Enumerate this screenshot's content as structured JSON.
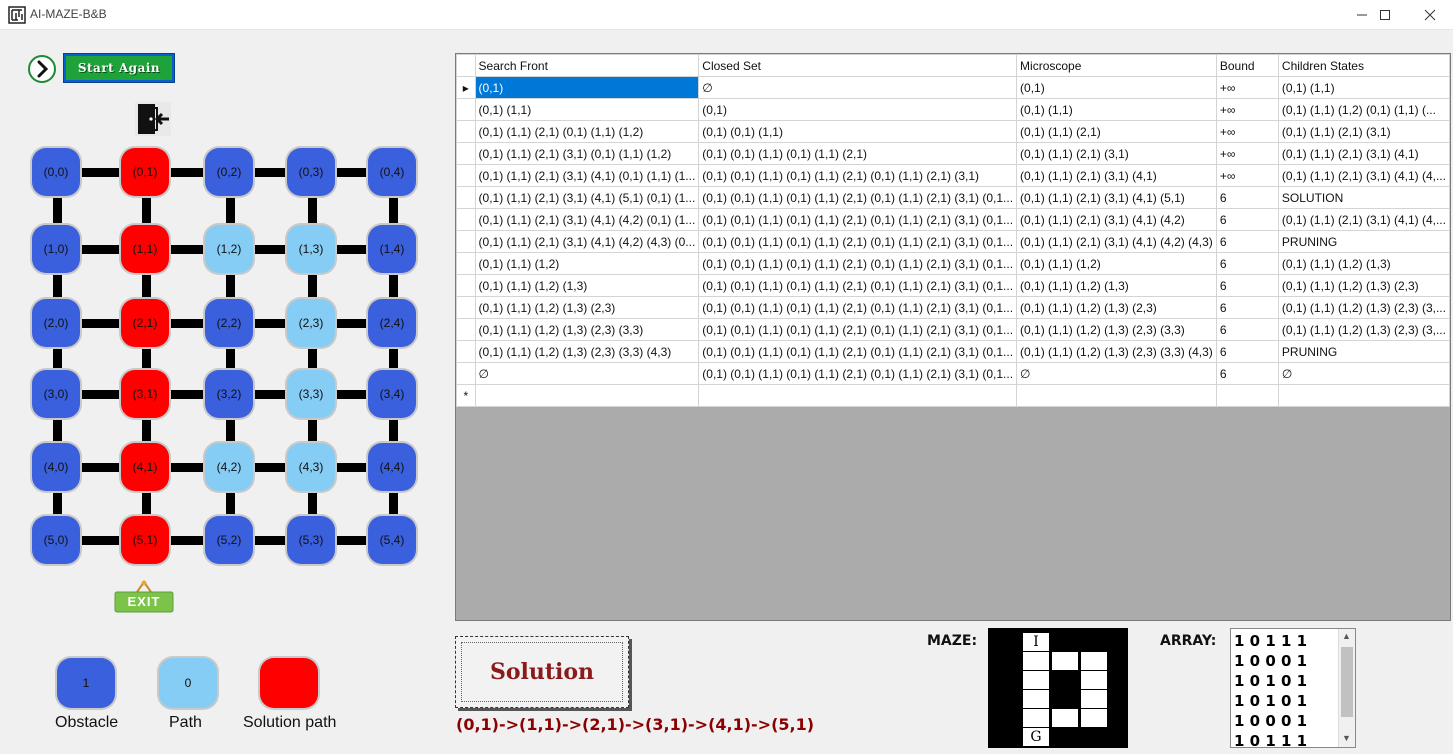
{
  "window": {
    "title": "AI-MAZE-B&B",
    "minimize_icon": "minimize-icon",
    "maximize_icon": "maximize-icon",
    "close_icon": "close-icon"
  },
  "controls": {
    "start_again_label": "Start Again",
    "go_icon": "chevron-right-circle-icon",
    "exit_door_icon": "exit-door-icon",
    "exit_sign_label": "EXIT"
  },
  "maze_nodes": [
    [
      {
        "label": "(0,0)",
        "type": "obs"
      },
      {
        "label": "(0,1)",
        "type": "sol"
      },
      {
        "label": "(0,2)",
        "type": "obs"
      },
      {
        "label": "(0,3)",
        "type": "obs"
      },
      {
        "label": "(0,4)",
        "type": "obs"
      }
    ],
    [
      {
        "label": "(1,0)",
        "type": "obs"
      },
      {
        "label": "(1,1)",
        "type": "sol"
      },
      {
        "label": "(1,2)",
        "type": "path"
      },
      {
        "label": "(1,3)",
        "type": "path"
      },
      {
        "label": "(1,4)",
        "type": "obs"
      }
    ],
    [
      {
        "label": "(2,0)",
        "type": "obs"
      },
      {
        "label": "(2,1)",
        "type": "sol"
      },
      {
        "label": "(2,2)",
        "type": "obs"
      },
      {
        "label": "(2,3)",
        "type": "path"
      },
      {
        "label": "(2,4)",
        "type": "obs"
      }
    ],
    [
      {
        "label": "(3,0)",
        "type": "obs"
      },
      {
        "label": "(3,1)",
        "type": "sol"
      },
      {
        "label": "(3,2)",
        "type": "obs"
      },
      {
        "label": "(3,3)",
        "type": "path"
      },
      {
        "label": "(3,4)",
        "type": "obs"
      }
    ],
    [
      {
        "label": "(4,0)",
        "type": "obs"
      },
      {
        "label": "(4,1)",
        "type": "sol"
      },
      {
        "label": "(4,2)",
        "type": "path"
      },
      {
        "label": "(4,3)",
        "type": "path"
      },
      {
        "label": "(4,4)",
        "type": "obs"
      }
    ],
    [
      {
        "label": "(5,0)",
        "type": "obs"
      },
      {
        "label": "(5,1)",
        "type": "sol"
      },
      {
        "label": "(5,2)",
        "type": "obs"
      },
      {
        "label": "(5,3)",
        "type": "obs"
      },
      {
        "label": "(5,4)",
        "type": "obs"
      }
    ]
  ],
  "legend": {
    "obstacle": {
      "value": "1",
      "label": "Obstacle"
    },
    "path": {
      "value": "0",
      "label": "Path"
    },
    "solution": {
      "value": "",
      "label": "Solution path"
    }
  },
  "colors": {
    "obstacle": "#3b60dd",
    "path": "#86cdf6",
    "solution": "#ff0000",
    "selected_cell": "#0078d7",
    "solution_text": "#8b0000"
  },
  "table": {
    "columns": [
      "Search Front",
      "Closed Set",
      "Microscope",
      "Bound",
      "Children States"
    ],
    "rows": [
      [
        "(0,1)",
        "∅",
        "(0,1)",
        "+∞",
        "(0,1) (1,1)"
      ],
      [
        "(0,1) (1,1)",
        "(0,1)",
        "(0,1) (1,1)",
        "+∞",
        "(0,1) (1,1) (1,2)   (0,1) (1,1) (..."
      ],
      [
        "(0,1) (1,1) (2,1)   (0,1) (1,1) (1,2)",
        "(0,1)   (0,1) (1,1)",
        "(0,1) (1,1) (2,1)",
        "+∞",
        "(0,1) (1,1) (2,1) (3,1)"
      ],
      [
        "(0,1) (1,1) (2,1) (3,1)   (0,1) (1,1) (1,2)",
        "(0,1)   (0,1) (1,1)   (0,1) (1,1) (2,1)",
        "(0,1) (1,1) (2,1) (3,1)",
        "+∞",
        "(0,1) (1,1) (2,1) (3,1) (4,1)"
      ],
      [
        "(0,1) (1,1) (2,1) (3,1) (4,1)   (0,1) (1,1) (1...",
        "(0,1)   (0,1) (1,1)   (0,1) (1,1) (2,1)   (0,1) (1,1) (2,1) (3,1)",
        "(0,1) (1,1) (2,1) (3,1) (4,1)",
        "+∞",
        "(0,1) (1,1) (2,1) (3,1) (4,1) (4,..."
      ],
      [
        "(0,1) (1,1) (2,1) (3,1) (4,1) (5,1)   (0,1) (1...",
        "(0,1)   (0,1) (1,1)   (0,1) (1,1) (2,1)   (0,1) (1,1) (2,1) (3,1)   (0,1...",
        "(0,1) (1,1) (2,1) (3,1) (4,1) (5,1)",
        "6",
        "SOLUTION"
      ],
      [
        "(0,1) (1,1) (2,1) (3,1) (4,1) (4,2)   (0,1) (1...",
        "(0,1)   (0,1) (1,1)   (0,1) (1,1) (2,1)   (0,1) (1,1) (2,1) (3,1)   (0,1...",
        "(0,1) (1,1) (2,1) (3,1) (4,1) (4,2)",
        "6",
        "(0,1) (1,1) (2,1) (3,1) (4,1) (4,..."
      ],
      [
        "(0,1) (1,1) (2,1) (3,1) (4,1) (4,2) (4,3)   (0...",
        "(0,1)   (0,1) (1,1)   (0,1) (1,1) (2,1)   (0,1) (1,1) (2,1) (3,1)   (0,1...",
        "(0,1) (1,1) (2,1) (3,1) (4,1) (4,2) (4,3)",
        "6",
        "PRUNING"
      ],
      [
        "(0,1) (1,1) (1,2)",
        "(0,1)   (0,1) (1,1)   (0,1) (1,1) (2,1)   (0,1) (1,1) (2,1) (3,1)   (0,1...",
        "(0,1) (1,1) (1,2)",
        "6",
        "(0,1) (1,1) (1,2) (1,3)"
      ],
      [
        "(0,1) (1,1) (1,2) (1,3)",
        "(0,1)   (0,1) (1,1)   (0,1) (1,1) (2,1)   (0,1) (1,1) (2,1) (3,1)   (0,1...",
        "(0,1) (1,1) (1,2) (1,3)",
        "6",
        "(0,1) (1,1) (1,2) (1,3) (2,3)"
      ],
      [
        "(0,1) (1,1) (1,2) (1,3) (2,3)",
        "(0,1)   (0,1) (1,1)   (0,1) (1,1) (2,1)   (0,1) (1,1) (2,1) (3,1)   (0,1...",
        "(0,1) (1,1) (1,2) (1,3) (2,3)",
        "6",
        "(0,1) (1,1) (1,2) (1,3) (2,3) (3,..."
      ],
      [
        "(0,1) (1,1) (1,2) (1,3) (2,3) (3,3)",
        "(0,1)   (0,1) (1,1)   (0,1) (1,1) (2,1)   (0,1) (1,1) (2,1) (3,1)   (0,1...",
        "(0,1) (1,1) (1,2) (1,3) (2,3) (3,3)",
        "6",
        "(0,1) (1,1) (1,2) (1,3) (2,3) (3,..."
      ],
      [
        "(0,1) (1,1) (1,2) (1,3) (2,3) (3,3) (4,3)",
        "(0,1)   (0,1) (1,1)   (0,1) (1,1) (2,1)   (0,1) (1,1) (2,1) (3,1)   (0,1...",
        "(0,1) (1,1) (1,2) (1,3) (2,3) (3,3) (4,3)",
        "6",
        "PRUNING"
      ],
      [
        "∅",
        "(0,1)   (0,1) (1,1)   (0,1) (1,1) (2,1)   (0,1) (1,1) (2,1) (3,1)   (0,1...",
        "∅",
        "6",
        "∅"
      ]
    ],
    "current_row_marker": "▸",
    "new_row_marker": "*"
  },
  "bottom": {
    "solution_button_label": "Solution",
    "solution_path": "(0,1)->(1,1)->(2,1)->(3,1)->(4,1)->(5,1)",
    "maze_label": "MAZE:",
    "array_label": "ARRAY:",
    "mini_maze_start": "I",
    "mini_maze_goal": "G",
    "array_lines": [
      "1 0 1 1 1",
      "1 0 0 0 1",
      "1 0 1 0 1",
      "1 0 1 0 1",
      "1 0 0 0 1",
      "1 0 1 1 1"
    ]
  }
}
